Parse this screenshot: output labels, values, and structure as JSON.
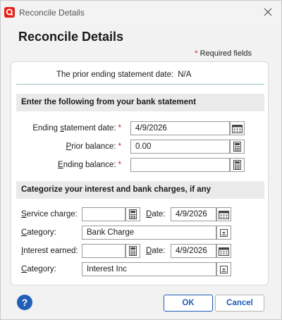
{
  "window": {
    "title": "Reconcile Details"
  },
  "heading": "Reconcile Details",
  "required_note": {
    "star": "*",
    "text": "Required fields"
  },
  "prior_statement": {
    "label": "The prior ending statement date:",
    "value": "N/A"
  },
  "section_bank": {
    "title": "Enter the following from your bank statement",
    "ending_date": {
      "label_pre": "Ending ",
      "label_ul": "s",
      "label_post": "tatement date:",
      "star": "*",
      "value": "4/9/2026"
    },
    "prior_balance": {
      "label_ul": "P",
      "label_post": "rior balance:",
      "star": "*",
      "value": "0.00"
    },
    "ending_balance": {
      "label_ul": "E",
      "label_post": "nding balance:",
      "star": "*",
      "value": ""
    }
  },
  "section_charges": {
    "title": "Categorize your interest and bank charges, if any",
    "service_charge": {
      "label_ul": "S",
      "label_post": "ervice charge:",
      "value": ""
    },
    "service_date": {
      "label_ul": "D",
      "label_post": "ate:",
      "value": "4/9/2026"
    },
    "service_category": {
      "label_ul": "C",
      "label_post": "ategory:",
      "value": "Bank Charge"
    },
    "interest_earned": {
      "label_ul": "I",
      "label_post": "nterest earned:",
      "value": ""
    },
    "interest_date": {
      "label_ul": "D",
      "label_post": "ate:",
      "value": "4/9/2026"
    },
    "interest_category": {
      "label_ul": "C",
      "label_post": "ategory:",
      "value": "Interest Inc"
    }
  },
  "buttons": {
    "help": "?",
    "ok": "OK",
    "cancel": "Cancel"
  },
  "icons": {
    "app": "quicken-logo-icon",
    "close": "close-icon",
    "calendar": "calendar-icon",
    "calculator": "calculator-icon",
    "category_list": "list-dropdown-icon",
    "help": "help-icon"
  },
  "colors": {
    "required_star": "#d01a1a",
    "accent": "#1f5fb8",
    "app_icon": "#e2231a"
  }
}
